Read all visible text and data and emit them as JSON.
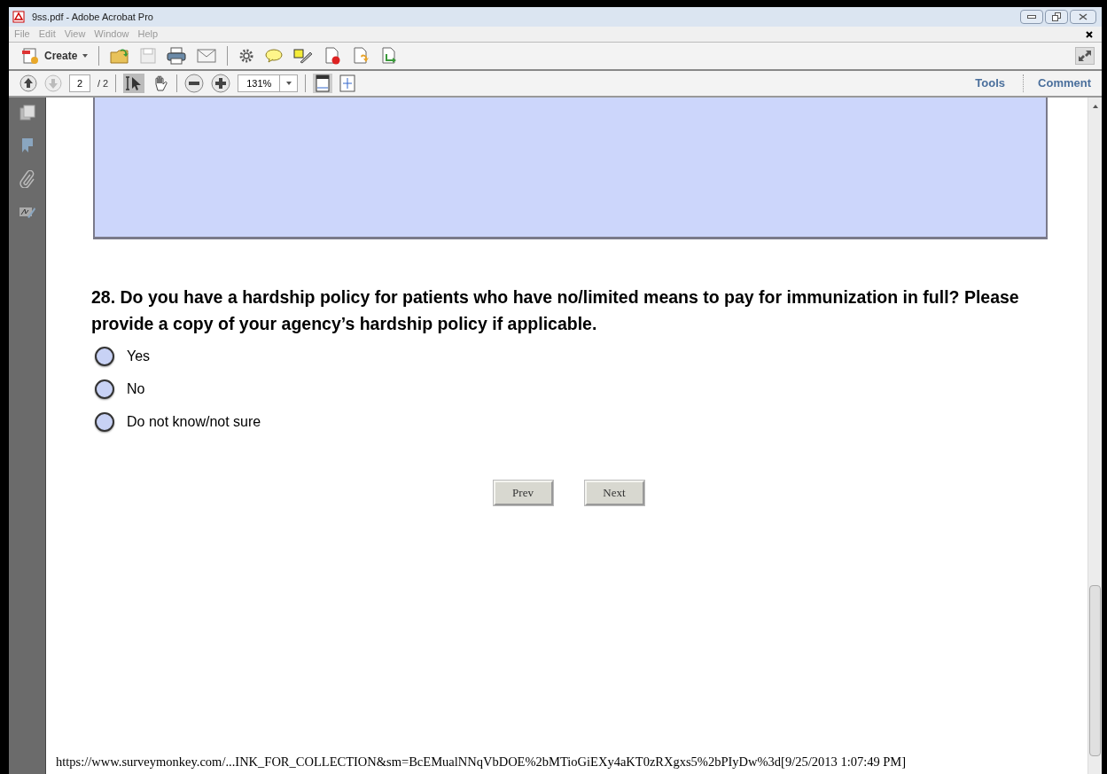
{
  "window": {
    "title": "9ss.pdf - Adobe Acrobat Pro"
  },
  "menu": [
    "File",
    "Edit",
    "View",
    "Window",
    "Help"
  ],
  "toolbar": {
    "create_label": "Create"
  },
  "nav": {
    "page": "2",
    "page_count": "/ 2",
    "zoom": "131%",
    "tools": "Tools",
    "comment": "Comment"
  },
  "question": {
    "text": "28. Do you have a hardship policy for patients who have no/limited means to pay for immunization in full? Please provide a copy of your agency’s hardship policy if applicable.",
    "options": [
      {
        "label": "Yes",
        "selected": false
      },
      {
        "label": "No",
        "selected": false
      },
      {
        "label": "Do not know/not sure",
        "selected": false
      }
    ]
  },
  "buttons": [
    "Prev",
    "Next"
  ],
  "footer": "https://www.surveymonkey.com/...INK_FOR_COLLECTION&sm=BcEMualNNqVbDOE%2bMTioGiEXy4aKT0zRXgxs5%2bPIyDw%3d[9/25/2013 1:07:49 PM]"
}
